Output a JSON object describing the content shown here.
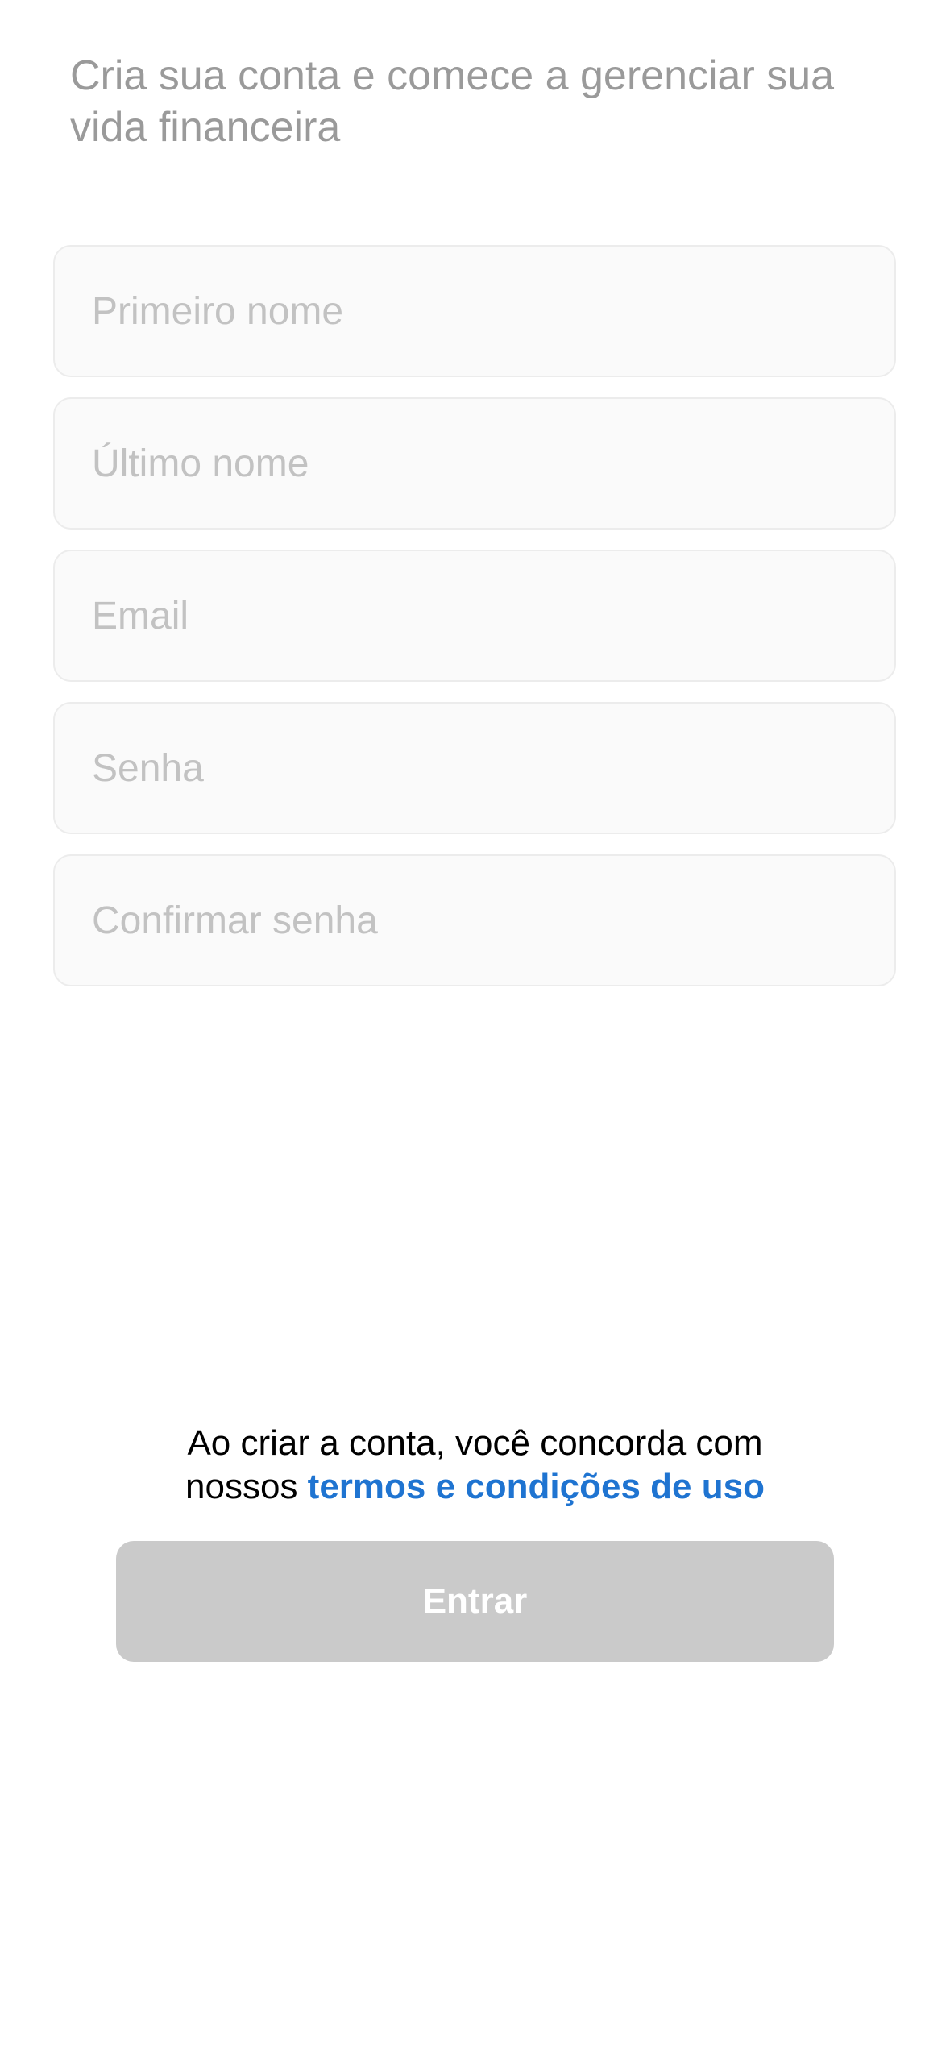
{
  "header": {
    "subtitle": "Cria sua conta e comece a gerenciar sua vida financeira"
  },
  "form": {
    "first_name": {
      "placeholder": "Primeiro nome",
      "value": ""
    },
    "last_name": {
      "placeholder": "Último nome",
      "value": ""
    },
    "email": {
      "placeholder": "Email",
      "value": ""
    },
    "password": {
      "placeholder": "Senha",
      "value": ""
    },
    "confirm_password": {
      "placeholder": "Confirmar senha",
      "value": ""
    }
  },
  "terms": {
    "line1": "Ao criar a conta, você concorda com",
    "line2_prefix": "nossos ",
    "link_text": "termos e condições de uso"
  },
  "actions": {
    "submit_label": "Entrar"
  },
  "colors": {
    "link": "#1f74d1",
    "button_disabled_bg": "#cacaca",
    "subtitle_text": "#9a9a9a",
    "placeholder_text": "#c2c2c2"
  }
}
